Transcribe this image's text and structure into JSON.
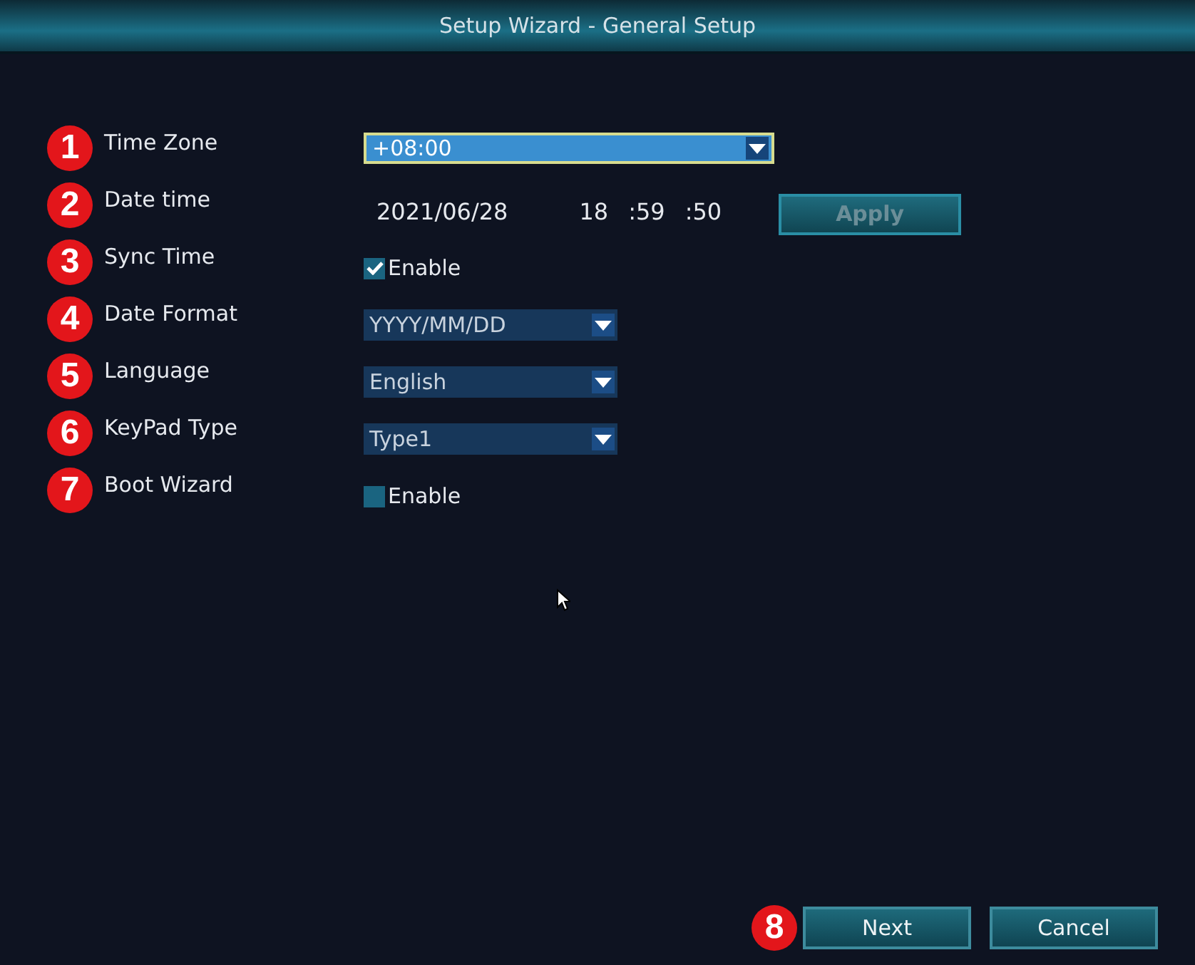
{
  "window": {
    "title": "Setup Wizard - General Setup"
  },
  "rows": [
    {
      "marker": "1",
      "label": "Time Zone",
      "kind": "select",
      "value": "+08:00",
      "focused": true
    },
    {
      "marker": "2",
      "label": "Date time",
      "kind": "datetime",
      "date": "2021/06/28",
      "time": [
        "18",
        ":59",
        ":50"
      ],
      "button": {
        "label": "Apply",
        "disabled": true
      }
    },
    {
      "marker": "3",
      "label": "Sync Time",
      "kind": "checkbox",
      "text": "Enable",
      "checked": true
    },
    {
      "marker": "4",
      "label": "Date Format",
      "kind": "select",
      "value": "YYYY/MM/DD",
      "focused": false
    },
    {
      "marker": "5",
      "label": "Language",
      "kind": "select",
      "value": "English",
      "focused": false
    },
    {
      "marker": "6",
      "label": "KeyPad Type",
      "kind": "select",
      "value": "Type1",
      "focused": false
    },
    {
      "marker": "7",
      "label": "Boot Wizard",
      "kind": "checkbox",
      "text": "Enable",
      "checked": false
    }
  ],
  "footer": {
    "marker": "8",
    "buttons": [
      {
        "label": "Next"
      },
      {
        "label": "Cancel"
      }
    ]
  }
}
